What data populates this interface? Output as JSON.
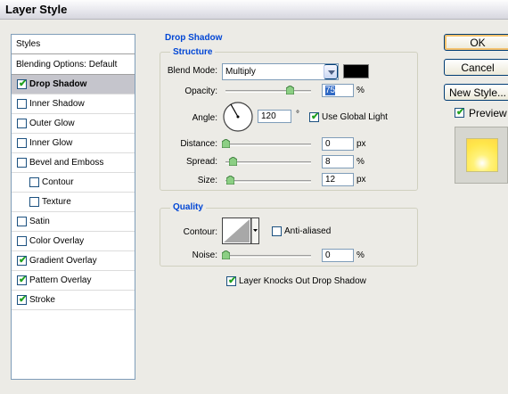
{
  "window": {
    "title": "Layer Style"
  },
  "styles_panel": {
    "header": "Styles",
    "blending_options": "Blending Options: Default",
    "items": [
      {
        "label": "Drop Shadow",
        "checked": true,
        "selected": true,
        "indent": false
      },
      {
        "label": "Inner Shadow",
        "checked": false,
        "selected": false,
        "indent": false
      },
      {
        "label": "Outer Glow",
        "checked": false,
        "selected": false,
        "indent": false
      },
      {
        "label": "Inner Glow",
        "checked": false,
        "selected": false,
        "indent": false
      },
      {
        "label": "Bevel and Emboss",
        "checked": false,
        "selected": false,
        "indent": false
      },
      {
        "label": "Contour",
        "checked": false,
        "selected": false,
        "indent": true
      },
      {
        "label": "Texture",
        "checked": false,
        "selected": false,
        "indent": true
      },
      {
        "label": "Satin",
        "checked": false,
        "selected": false,
        "indent": false
      },
      {
        "label": "Color Overlay",
        "checked": false,
        "selected": false,
        "indent": false
      },
      {
        "label": "Gradient Overlay",
        "checked": true,
        "selected": false,
        "indent": false
      },
      {
        "label": "Pattern Overlay",
        "checked": true,
        "selected": false,
        "indent": false
      },
      {
        "label": "Stroke",
        "checked": true,
        "selected": false,
        "indent": false
      }
    ]
  },
  "drop_shadow": {
    "title": "Drop Shadow",
    "structure": {
      "title": "Structure",
      "blend_mode_label": "Blend Mode:",
      "blend_mode_value": "Multiply",
      "shadow_color": "#000000",
      "opacity_label": "Opacity:",
      "opacity_value": "75",
      "opacity_unit": "%",
      "opacity_slider_fraction": 0.75,
      "angle_label": "Angle:",
      "angle_value": "120",
      "angle_unit": "°",
      "use_global_light_label": "Use Global Light",
      "use_global_light_checked": true,
      "distance_label": "Distance:",
      "distance_value": "0",
      "distance_unit": "px",
      "distance_slider_fraction": 0.0,
      "spread_label": "Spread:",
      "spread_value": "8",
      "spread_unit": "%",
      "spread_slider_fraction": 0.08,
      "size_label": "Size:",
      "size_value": "12",
      "size_unit": "px",
      "size_slider_fraction": 0.05
    },
    "quality": {
      "title": "Quality",
      "contour_label": "Contour:",
      "anti_aliased_label": "Anti-aliased",
      "anti_aliased_checked": false,
      "noise_label": "Noise:",
      "noise_value": "0",
      "noise_unit": "%",
      "noise_slider_fraction": 0.0
    },
    "knockout_label": "Layer Knocks Out Drop Shadow",
    "knockout_checked": true
  },
  "buttons": {
    "ok": "OK",
    "cancel": "Cancel",
    "new_style": "New Style...",
    "preview_label": "Preview",
    "preview_checked": true
  }
}
